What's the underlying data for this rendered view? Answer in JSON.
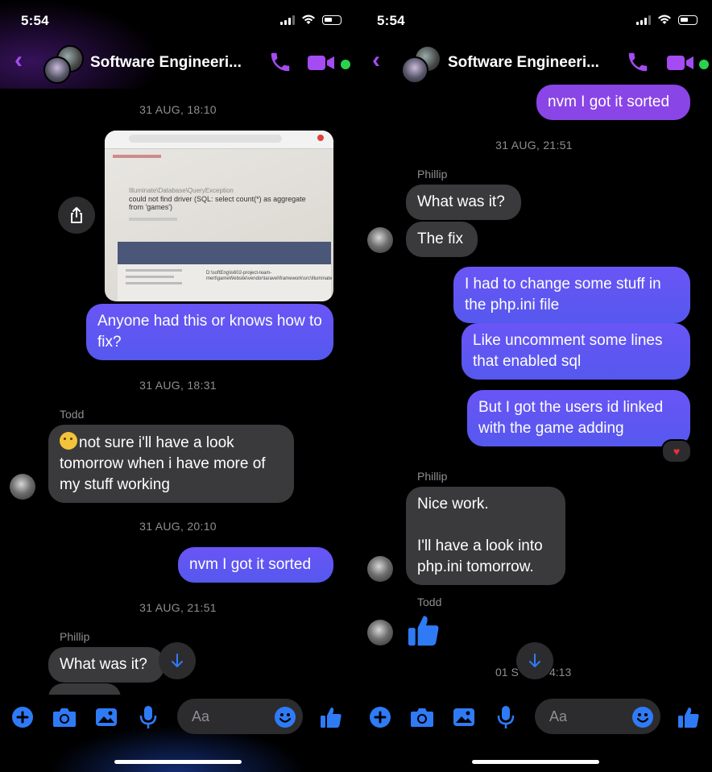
{
  "status": {
    "time": "5:54"
  },
  "conversation": {
    "title": "Software Engineeri..."
  },
  "composer": {
    "placeholder": "Aa"
  },
  "left": {
    "timestamps": [
      "31 AUG, 18:10",
      "31 AUG, 18:31",
      "31 AUG, 20:10",
      "31 AUG, 21:51"
    ],
    "image_texts": {
      "exception": "Illuminate\\Database\\QueryException",
      "error": "could not find driver (SQL: select count(*) as aggregate from 'games')",
      "path": "D:\\softEng\\is602-project-team-mert\\gameWebsite\\vendor\\laravel\\framework\\src\\Illuminate"
    },
    "messages": {
      "m1": "Anyone had this or knows how to fix?",
      "todd_name": "Todd",
      "m2": "not sure i'll have a look tomorrow when i have more of my stuff working",
      "m3": "nvm I got it sorted",
      "phillip_name": "Phillip",
      "m4": "What was it?"
    }
  },
  "right": {
    "timestamps": [
      "31 AUG, 21:51",
      "01 S",
      "4:13"
    ],
    "messages": {
      "m0": "nvm I got it sorted",
      "phillip_name": "Phillip",
      "m1": "What was it?",
      "m2": "The fix",
      "m3": "I had to change some stuff in the php.ini file",
      "m4": "Like uncomment some lines that enabled sql",
      "m5": "But I got the users id linked with the game adding",
      "phillip_name2": "Phillip",
      "m6a": "Nice work.",
      "m6b": "I'll have a look into php.ini tomorrow.",
      "todd_name": "Todd"
    }
  },
  "colors": {
    "accent": "#a44bf2",
    "outgoing": "#5c56f2",
    "incoming": "#3a3a3c",
    "composer_icons": "#2f7bf6",
    "online": "#2bd24d"
  }
}
